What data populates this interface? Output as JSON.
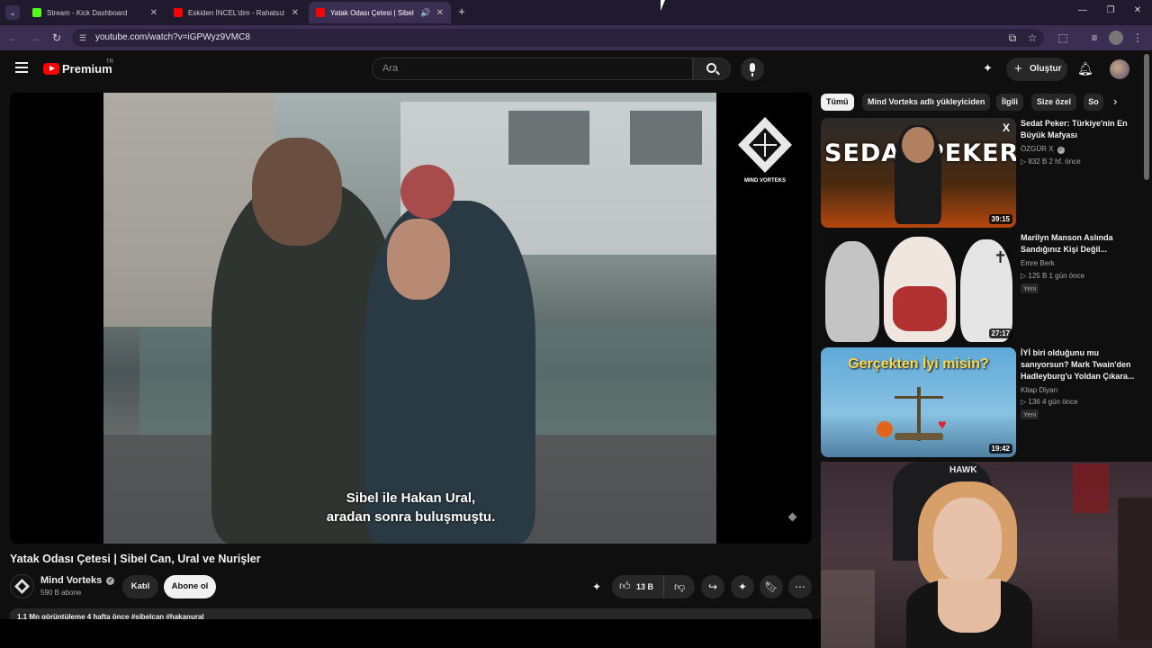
{
  "browser": {
    "tabs": [
      {
        "title": "Stream - Kick Dashboard",
        "favicon_color": "#53fc18"
      },
      {
        "title": "Eskiden İNCEL'dim - Rahatsız E",
        "favicon_color": "#ff0000"
      },
      {
        "title": "Yatak Odası Çetesi | Sibel C",
        "favicon_color": "#ff0000"
      }
    ],
    "url": "youtube.com/watch?v=iGPWyz9VMC8"
  },
  "masthead": {
    "logo_text": "Premium",
    "logo_region": "TR",
    "search_placeholder": "Ara",
    "create_label": "Oluştur"
  },
  "player": {
    "subtitle_line1": "Sibel ile Hakan Ural,",
    "subtitle_line2": "aradan sonra buluşmuştu.",
    "watermark_label": "MIND VORTEKS"
  },
  "video": {
    "title": "Yatak Odası Çetesi | Sibel Can, Ural ve Nurişler",
    "channel_name": "Mind Vorteks",
    "subscribers": "590 B abone",
    "join_label": "Katıl",
    "subscribe_label": "Abone ol",
    "likes": "13 B",
    "description_preview": "1,1 Mn görüntüleme  4 hafta önce  #sibelcan #hakanural"
  },
  "chips": [
    "Tümü",
    "Mind Vorteks adlı yükleyiciden",
    "İlgili",
    "Size özel",
    "So"
  ],
  "recommendations": [
    {
      "title": "Sedat Peker: Türkiye'nin En Büyük Mafyası",
      "channel": "ÖZGÜR X",
      "meta": "▷ 832 B   2 hf. önce",
      "duration": "39:15",
      "thumb_text": "SEDAT PEKER",
      "badge": ""
    },
    {
      "title": "Marilyn Manson Aslında Sandığınız Kişi Değil...",
      "channel": "Emre Berk",
      "meta": "▷ 125 B   1 gün önce",
      "duration": "27:17",
      "thumb_text": "",
      "badge": "Yeni"
    },
    {
      "title": "İYİ biri olduğunu mu sanıyorsun? Mark Twain'den Hadleyburg'u Yoldan Çıkara...",
      "channel": "Kitap Diyarı",
      "meta": "▷ 136   4 gün önce",
      "duration": "19:42",
      "thumb_text": "Gerçekten İyi misin?",
      "badge": "Yeni"
    }
  ],
  "webcam": {
    "poster_text": "HAWK"
  }
}
